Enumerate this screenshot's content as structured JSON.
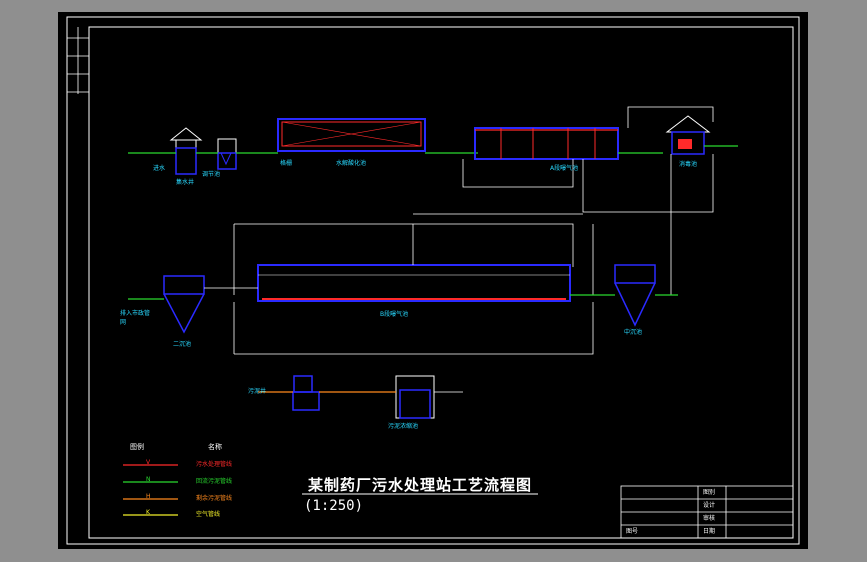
{
  "drawing": {
    "title": "某制药厂污水处理站工艺流程图",
    "scale": "(1:250)"
  },
  "units": {
    "collection_well": "集水井",
    "grid": "格栅",
    "reg_pool": "调节池",
    "hydrolysis": "水解酸化池",
    "a_pool": "A段曝气池",
    "disinfection": "消毒池",
    "b_pool": "B段曝气池",
    "secondary_settler": "二沉池",
    "mid_settler": "中沉池",
    "sludge_well": "污泥井",
    "sludge_thickener": "污泥浓缩池",
    "discharge": "排入市政管网"
  },
  "legend": {
    "header_symbol": "图例",
    "header_name": "名称",
    "rows": [
      {
        "code": "V",
        "name": "污水处理管线",
        "color": "#ff2a2a"
      },
      {
        "code": "N",
        "name": "回流污泥管线",
        "color": "#29d92f"
      },
      {
        "code": "H",
        "name": "剩余污泥管线",
        "color": "#ff8a1e"
      },
      {
        "code": "K",
        "name": "空气管线",
        "color": "#f3f02a"
      }
    ]
  },
  "title_block": {
    "school": "图别",
    "design": "设计",
    "check": "审核",
    "date": "日期",
    "sheet": "图号"
  }
}
